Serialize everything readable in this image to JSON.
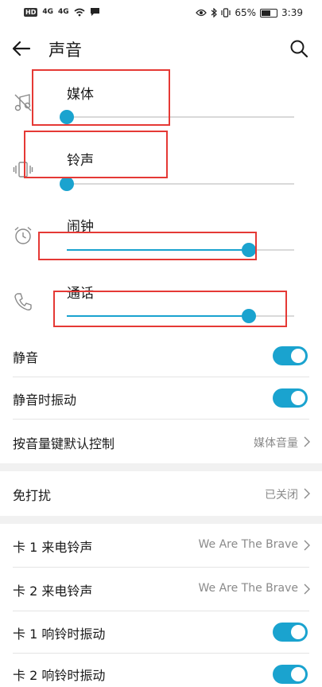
{
  "status_bar": {
    "hd": "HD",
    "net1": "4G",
    "net2": "4G",
    "battery_text": "65%",
    "battery_level": 0.65,
    "time": "3:39"
  },
  "header": {
    "title": "声音",
    "back_icon": "arrow-left-icon",
    "search_icon": "search-icon"
  },
  "volumes": [
    {
      "label": "媒体",
      "icon": "media-muted-icon",
      "level": 0.0
    },
    {
      "label": "铃声",
      "icon": "vibrate-icon",
      "level": 0.0
    },
    {
      "label": "闹钟",
      "icon": "alarm-clock-icon",
      "level": 0.8
    },
    {
      "label": "通话",
      "icon": "phone-icon",
      "level": 0.8
    }
  ],
  "settings": {
    "silent": {
      "label": "静音",
      "on": true
    },
    "silent_vibrate": {
      "label": "静音时振动",
      "on": true
    },
    "volume_key": {
      "label": "按音量键默认控制",
      "value": "媒体音量"
    },
    "dnd": {
      "label": "免打扰",
      "value": "已关闭"
    },
    "sim1_ringtone": {
      "label": "卡 1 来电铃声",
      "value": "We Are The Brave"
    },
    "sim2_ringtone": {
      "label": "卡 2 来电铃声",
      "value": "We Are The Brave"
    },
    "sim1_vibrate": {
      "label": "卡 1 响铃时振动",
      "on": true
    },
    "sim2_vibrate": {
      "label": "卡 2 响铃时振动",
      "on": true
    }
  },
  "colors": {
    "accent": "#1aa3cf",
    "highlight": "#e53935"
  }
}
